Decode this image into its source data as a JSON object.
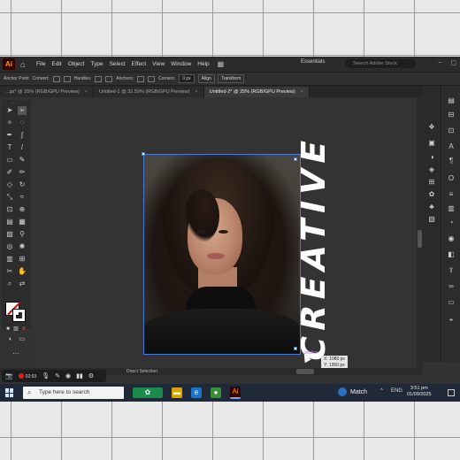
{
  "app": {
    "logo": "Ai",
    "menu": [
      "File",
      "Edit",
      "Object",
      "Type",
      "Select",
      "Effect",
      "View",
      "Window",
      "Help"
    ],
    "workspace": "Essentials",
    "search_placeholder": "Search Adobe Stock"
  },
  "control_bar": {
    "mode": "Anchor Point",
    "convert": "Convert:",
    "handles": "Handles:",
    "anchors": "Anchors:",
    "corners": "Corners:",
    "corner_value": "0 px",
    "align": "Align",
    "transform": "Transform"
  },
  "tabs": [
    {
      "label": "...gs* @ 25% (RGB/GPU Preview)",
      "active": false
    },
    {
      "label": "Untitled-1 @ 32.59% (RGB/GPU Preview)",
      "active": false
    },
    {
      "label": "Untitled-2* @ 25% (RGB/GPU Preview)",
      "active": true
    }
  ],
  "artboard": {
    "text": "CREATIVE",
    "anchor_label": "anchor",
    "dimension_x": "X: 1080 px",
    "dimension_y": "Y: 1350 px"
  },
  "status": {
    "tool": "Direct Selection"
  },
  "recorder": {
    "time": "02:03"
  },
  "taskbar": {
    "search_placeholder": "Type here to search",
    "widget": "Match",
    "language": "ENG",
    "time": "3:51 pm",
    "date": "01/09/2025"
  },
  "colors": {
    "accent_blue": "#4a78d6",
    "ai_orange": "#ff9a00",
    "anchor_magenta": "#c46bd8",
    "ui_dark": "#323232"
  }
}
